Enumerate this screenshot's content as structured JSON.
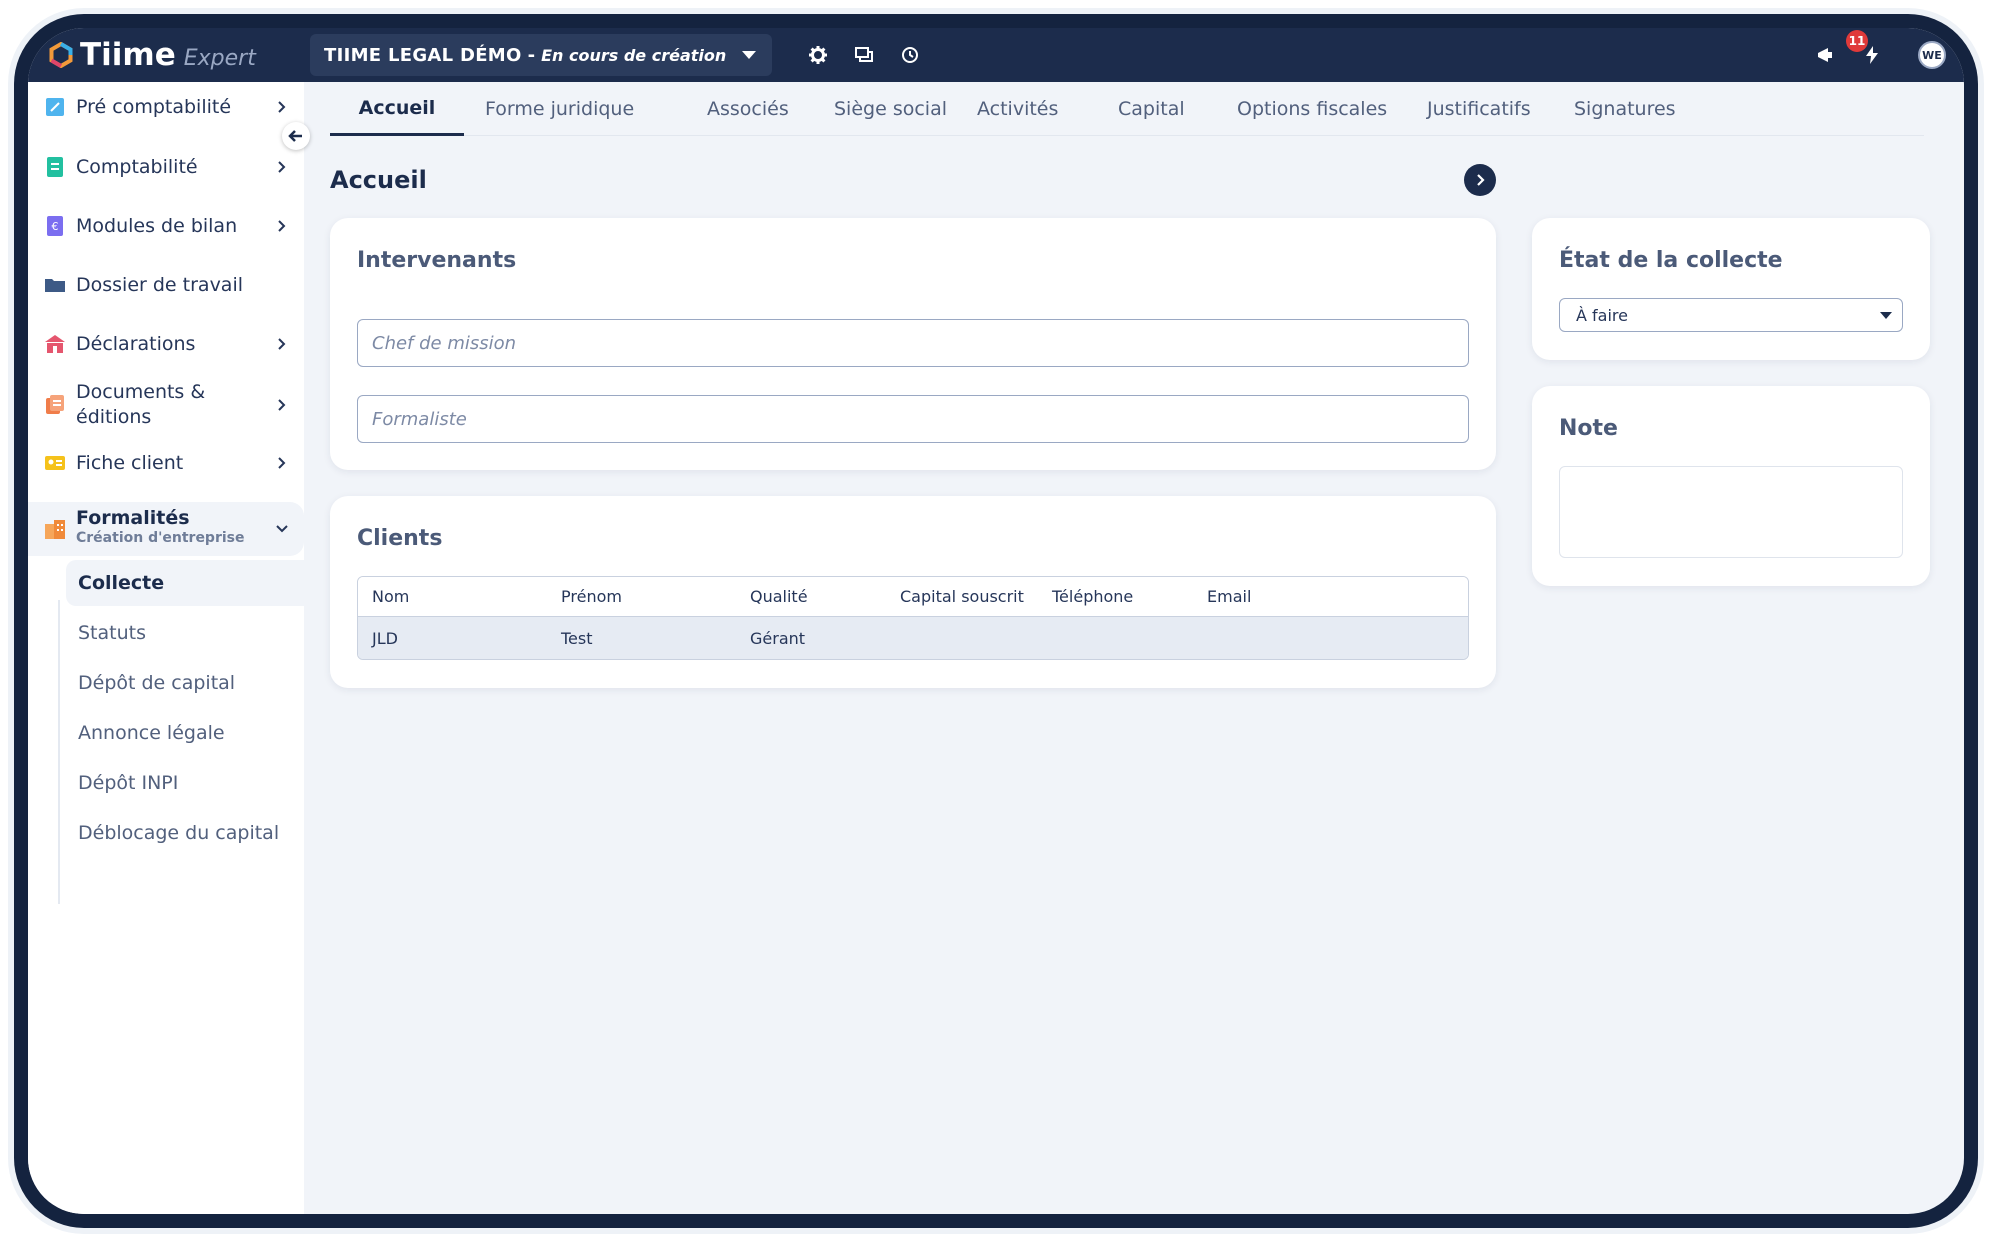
{
  "app": {
    "brand": "Tiime",
    "product": "Expert",
    "company_name": "TIIME LEGAL DÉMO",
    "company_separator": "-",
    "company_status": "En cours de création",
    "notifications_count": "11",
    "user_initials": "WE"
  },
  "sidebar": {
    "items": [
      {
        "label": "Pré comptabilité"
      },
      {
        "label": "Comptabilité"
      },
      {
        "label": "Modules de bilan"
      },
      {
        "label": "Dossier de travail"
      },
      {
        "label": "Déclarations"
      },
      {
        "label": "Documents & éditions"
      },
      {
        "label": "Fiche client"
      },
      {
        "label": "Formalités",
        "sublabel": "Création d'entreprise"
      }
    ],
    "subitems": [
      {
        "label": "Collecte"
      },
      {
        "label": "Statuts"
      },
      {
        "label": "Dépôt de capital"
      },
      {
        "label": "Annonce légale"
      },
      {
        "label": "Dépôt INPI"
      },
      {
        "label": "Déblocage du capital"
      }
    ]
  },
  "tabs": [
    {
      "label": "Accueil"
    },
    {
      "label": "Forme juridique"
    },
    {
      "label": "Associés"
    },
    {
      "label": "Siège social"
    },
    {
      "label": "Activités"
    },
    {
      "label": "Capital"
    },
    {
      "label": "Options fiscales"
    },
    {
      "label": "Justificatifs"
    },
    {
      "label": "Signatures"
    }
  ],
  "page": {
    "title": "Accueil"
  },
  "intervenants": {
    "title": "Intervenants",
    "chef_placeholder": "Chef de mission",
    "formaliste_placeholder": "Formaliste"
  },
  "clients": {
    "title": "Clients",
    "columns": [
      "Nom",
      "Prénom",
      "Qualité",
      "Capital souscrit",
      "Téléphone",
      "Email"
    ],
    "rows": [
      {
        "nom": "JLD",
        "prenom": "Test",
        "qualite": "Gérant",
        "capital": "",
        "telephone": "",
        "email": ""
      }
    ]
  },
  "etat": {
    "title": "État de la collecte",
    "selected": "À faire"
  },
  "note": {
    "title": "Note"
  },
  "colors": {
    "topbar": "#1c2c4c",
    "page_bg": "#f1f4f9",
    "badge": "#e03a3a"
  }
}
